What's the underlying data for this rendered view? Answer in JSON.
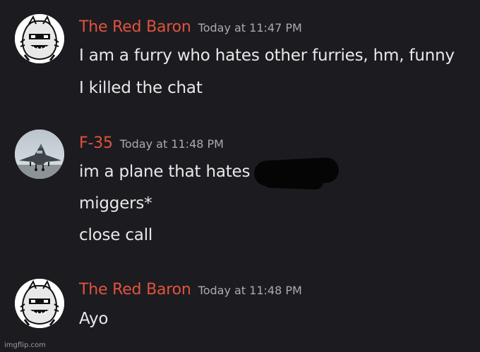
{
  "messages": [
    {
      "username": "The Red Baron",
      "timestamp": "Today at 11:47 PM",
      "avatar_icon": "cartoon-mascot-avatar",
      "lines": [
        "I am a furry who hates other furries, hm, funny",
        "I killed the chat"
      ]
    },
    {
      "username": "F-35",
      "timestamp": "Today at 11:48 PM",
      "avatar_icon": "fighter-jet-avatar",
      "lines": [
        "im a plane that hates",
        "miggers*",
        "close call"
      ]
    },
    {
      "username": "The Red Baron",
      "timestamp": "Today at 11:48 PM",
      "avatar_icon": "cartoon-mascot-avatar",
      "lines": [
        "Ayo"
      ]
    }
  ],
  "watermark": "imgflip.com",
  "colors": {
    "background": "#1c1c20",
    "username": "#e0533f",
    "timestamp": "#a9abb2",
    "text": "#e8e8ea"
  }
}
